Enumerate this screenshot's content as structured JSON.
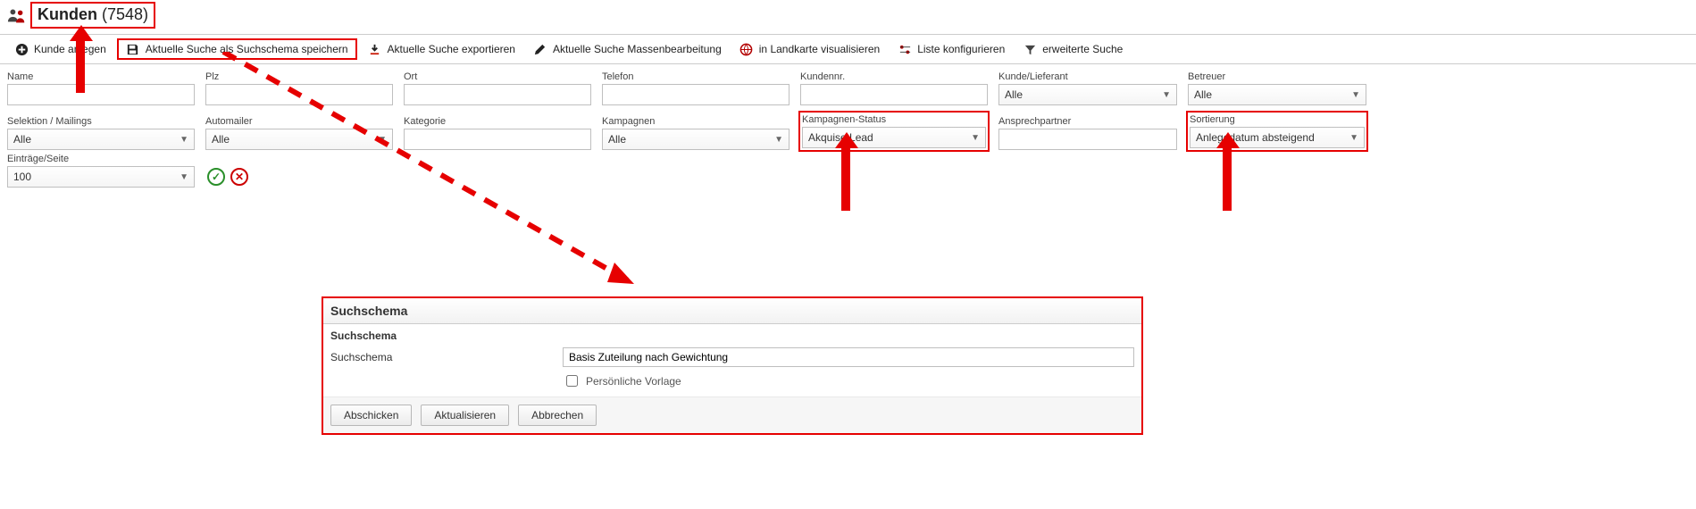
{
  "header": {
    "title_name": "Kunden",
    "count": "(7548)"
  },
  "toolbar": {
    "create": "Kunde anlegen",
    "save_schema": "Aktuelle Suche als Suchschema speichern",
    "export": "Aktuelle Suche exportieren",
    "bulk_edit": "Aktuelle Suche Massenbearbeitung",
    "map": "in Landkarte visualisieren",
    "configure_list": "Liste konfigurieren",
    "advanced_search": "erweiterte Suche"
  },
  "filters": {
    "row1": {
      "name_label": "Name",
      "name_value": "",
      "plz_label": "Plz",
      "plz_value": "",
      "ort_label": "Ort",
      "ort_value": "",
      "telefon_label": "Telefon",
      "telefon_value": "",
      "kundennr_label": "Kundennr.",
      "kundennr_value": "",
      "kunde_lieferant_label": "Kunde/Lieferant",
      "kunde_lieferant_value": "Alle",
      "betreuer_label": "Betreuer",
      "betreuer_value": "Alle"
    },
    "row2": {
      "selektion_label": "Selektion / Mailings",
      "selektion_value": "Alle",
      "automailer_label": "Automailer",
      "automailer_value": "Alle",
      "kategorie_label": "Kategorie",
      "kategorie_value": "",
      "kampagnen_label": "Kampagnen",
      "kampagnen_value": "Alle",
      "kampagnen_status_label": "Kampagnen-Status",
      "kampagnen_status_value": "Akquise Lead",
      "ansprechpartner_label": "Ansprechpartner",
      "ansprechpartner_value": "",
      "sortierung_label": "Sortierung",
      "sortierung_value": "Anlegedatum absteigend"
    },
    "entries": {
      "label": "Einträge/Seite",
      "value": "100"
    }
  },
  "dialog": {
    "title": "Suchschema",
    "section_label": "Suchschema",
    "field_label": "Suchschema",
    "field_value": "Basis Zuteilung nach Gewichtung",
    "personal_template_label": "Persönliche Vorlage",
    "submit": "Abschicken",
    "refresh": "Aktualisieren",
    "cancel": "Abbrechen"
  }
}
